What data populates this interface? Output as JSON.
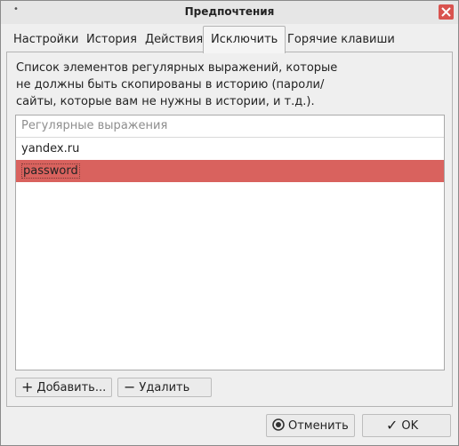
{
  "window": {
    "title": "Предпочтения"
  },
  "tabs": [
    {
      "label": "Настройки"
    },
    {
      "label": "История"
    },
    {
      "label": "Действия"
    },
    {
      "label": "Исключить",
      "active": true
    },
    {
      "label": "Горячие клавиши"
    }
  ],
  "panel": {
    "description_lines": [
      "Список элементов регулярных выражений, которые",
      "не должны быть скопированы в историю (пароли/",
      "сайты, которые вам не нужны в истории, и т.д.)."
    ],
    "list_header": "Регулярные выражения",
    "items": [
      {
        "label": "yandex.ru",
        "selected": false
      },
      {
        "label": "password",
        "selected": true
      }
    ],
    "add_button": "Добавить...",
    "remove_button": "Удалить"
  },
  "footer": {
    "cancel_button": "Отменить",
    "ok_button": "OK"
  },
  "colors": {
    "selection": "#d9625e",
    "close": "#d9534f"
  },
  "icons": [
    "close-icon",
    "plus-icon",
    "minus-icon",
    "cancel-icon",
    "check-icon"
  ]
}
